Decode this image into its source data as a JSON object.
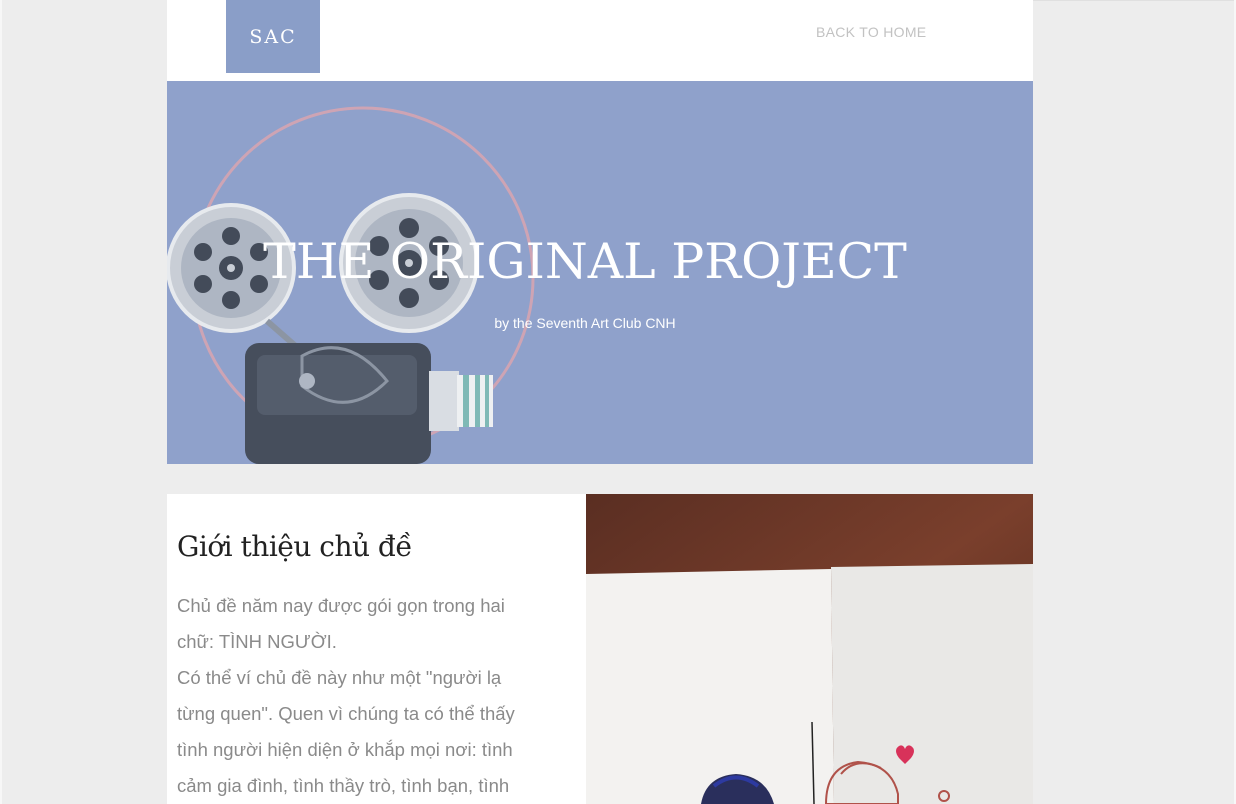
{
  "header": {
    "logo_text": "SAC",
    "nav_home": "BACK TO HOME"
  },
  "hero": {
    "title": "THE ORIGINAL PROJECT",
    "subtitle": "by the Seventh Art Club CNH"
  },
  "intro": {
    "title": "Giới thiệu chủ đề",
    "lines": [
      "Chủ đề năm nay được gói gọn trong hai",
      "chữ: TÌNH NGƯỜI.",
      "Có thể ví chủ đề này như một \"người lạ",
      "từng quen\". Quen vì chúng ta có thể thấy",
      "tình người hiện diện ở khắp mọi nơi: tình",
      "cảm gia đình, tình thầy trò, tình bạn, tình"
    ]
  },
  "colors": {
    "accent": "#8a9ec8",
    "hero_bg": "#8fa1cb",
    "page_bg": "#ededed"
  },
  "icons": [
    "film-projector-illustration"
  ]
}
